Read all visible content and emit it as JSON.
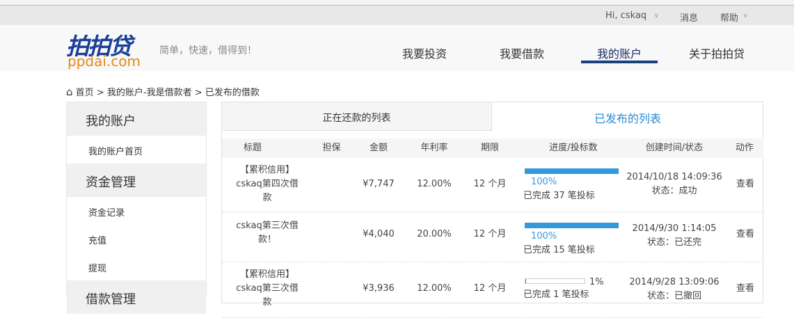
{
  "topbar": {
    "greeting": "Hi, cskaq",
    "messages": "消息",
    "help": "帮助"
  },
  "logo": {
    "cn": "拍拍贷",
    "en": "ppdai.com",
    "slogan": "简单，快速，借得到！"
  },
  "nav": [
    "我要投资",
    "我要借款",
    "我的账户",
    "关于拍拍贷"
  ],
  "breadcrumb": {
    "home": "首页",
    "sep": ">",
    "level1": "我的账户-我是借款者",
    "level2": "已发布的借款"
  },
  "sidebar": {
    "h1": "我的账户",
    "i1": "我的账户首页",
    "h2": "资金管理",
    "i2": "资金记录",
    "i3": "充值",
    "i4": "提现",
    "h3": "借款管理"
  },
  "tabs": [
    "正在还款的列表",
    "已发布的列表"
  ],
  "columns": [
    "标题",
    "担保",
    "金额",
    "年利率",
    "期限",
    "进度/投标数",
    "创建时间/状态",
    "动作"
  ],
  "rows": [
    {
      "title": "【累积信用】cskaq第四次借款",
      "amount": "¥7,747",
      "rate": "12.00%",
      "term": "12 个月",
      "progress": 100,
      "progress_label": "100%",
      "bids": "已完成 37 笔投标",
      "created": "2014/10/18 14:09:36",
      "status": "状态：成功",
      "action": "查看"
    },
    {
      "title": "cskaq第三次借款！",
      "amount": "¥4,040",
      "rate": "20.00%",
      "term": "12 个月",
      "progress": 100,
      "progress_label": "100%",
      "bids": "已完成 15 笔投标",
      "created": "2014/9/30 1:14:05",
      "status": "状态：已还完",
      "action": "查看"
    },
    {
      "title": "【累积信用】cskaq第三次借款",
      "amount": "¥3,936",
      "rate": "12.00%",
      "term": "12 个月",
      "progress": 1,
      "progress_label": "1%",
      "bids": "已完成 1 笔投标",
      "created": "2014/9/28 13:09:06",
      "status": "状态：已撤回",
      "action": "查看"
    }
  ],
  "colors": {
    "accent": "#3399dd",
    "brand": "#1a3f96",
    "orange": "#e38a14"
  }
}
